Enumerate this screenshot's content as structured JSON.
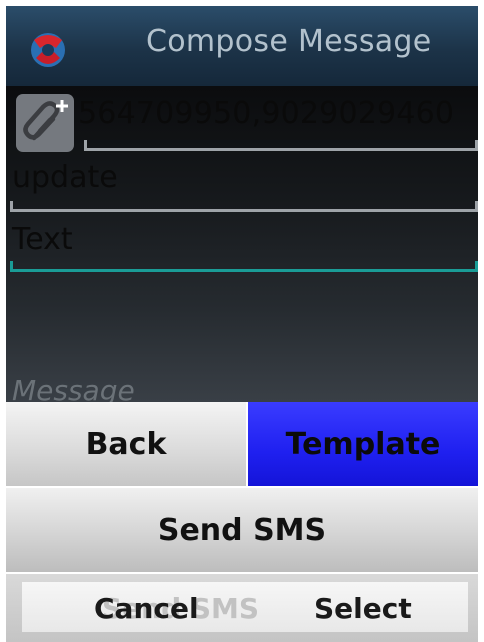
{
  "header": {
    "title": "Compose Message",
    "logo_icon": "app-logo-icon"
  },
  "compose": {
    "attach_icon": "paperclip-add-icon",
    "recipients": "564709950,9029029460",
    "subject": "update",
    "text_field": "Text",
    "message_placeholder": "Message",
    "colors": {
      "focus_underline": "#1a9c96",
      "underline": "#9ea3a8"
    }
  },
  "menu": {
    "back_label": "Back",
    "template_label": "Template",
    "send_sms_label": "Send SMS",
    "selected_item": "Template",
    "selected_color": "#1f20f0"
  },
  "softkeys": {
    "background_label": "Send SMS",
    "left_label": "Cancel",
    "right_label": "Select"
  }
}
